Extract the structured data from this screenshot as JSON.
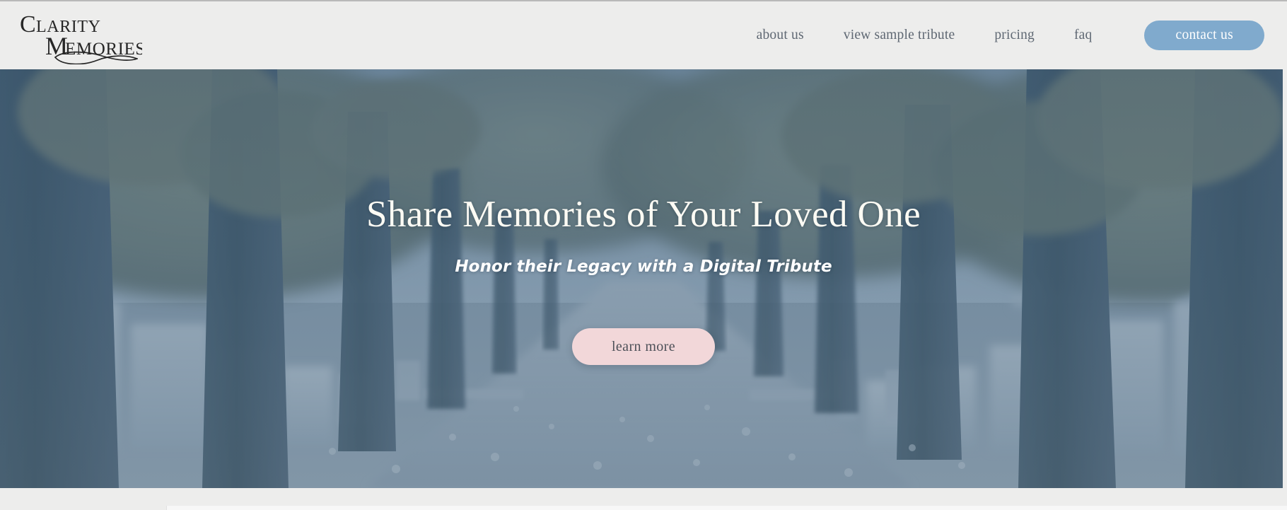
{
  "brand": {
    "name": "Clarity Memories",
    "line1": "CLARITY",
    "line2": "MEMORIES",
    "flourish": "ribbon-flourish"
  },
  "nav": {
    "items": [
      {
        "label": "about us",
        "name": "nav-about-us"
      },
      {
        "label": "view sample tribute",
        "name": "nav-view-sample-tribute"
      },
      {
        "label": "pricing",
        "name": "nav-pricing"
      },
      {
        "label": "faq",
        "name": "nav-faq"
      }
    ],
    "cta": {
      "label": "contact us",
      "bg": "#80aacd",
      "color": "#ffffff"
    }
  },
  "hero": {
    "title": "Share Memories of Your Loved One",
    "subtitle": "Honor their Legacy with a Digital Tribute",
    "cta": {
      "label": "learn more",
      "bg": "#f2d7d9",
      "color": "#4d5058"
    },
    "image_alt": "tree-lined cemetery path with gravestones in autumn",
    "overlay_tint": "#4d6275"
  },
  "theme": {
    "header_bg": "#ededec",
    "accent_blue": "#80aacd",
    "accent_pink": "#f2d7d9",
    "nav_text": "#5f6873",
    "hero_text": "#fdfbf4"
  }
}
